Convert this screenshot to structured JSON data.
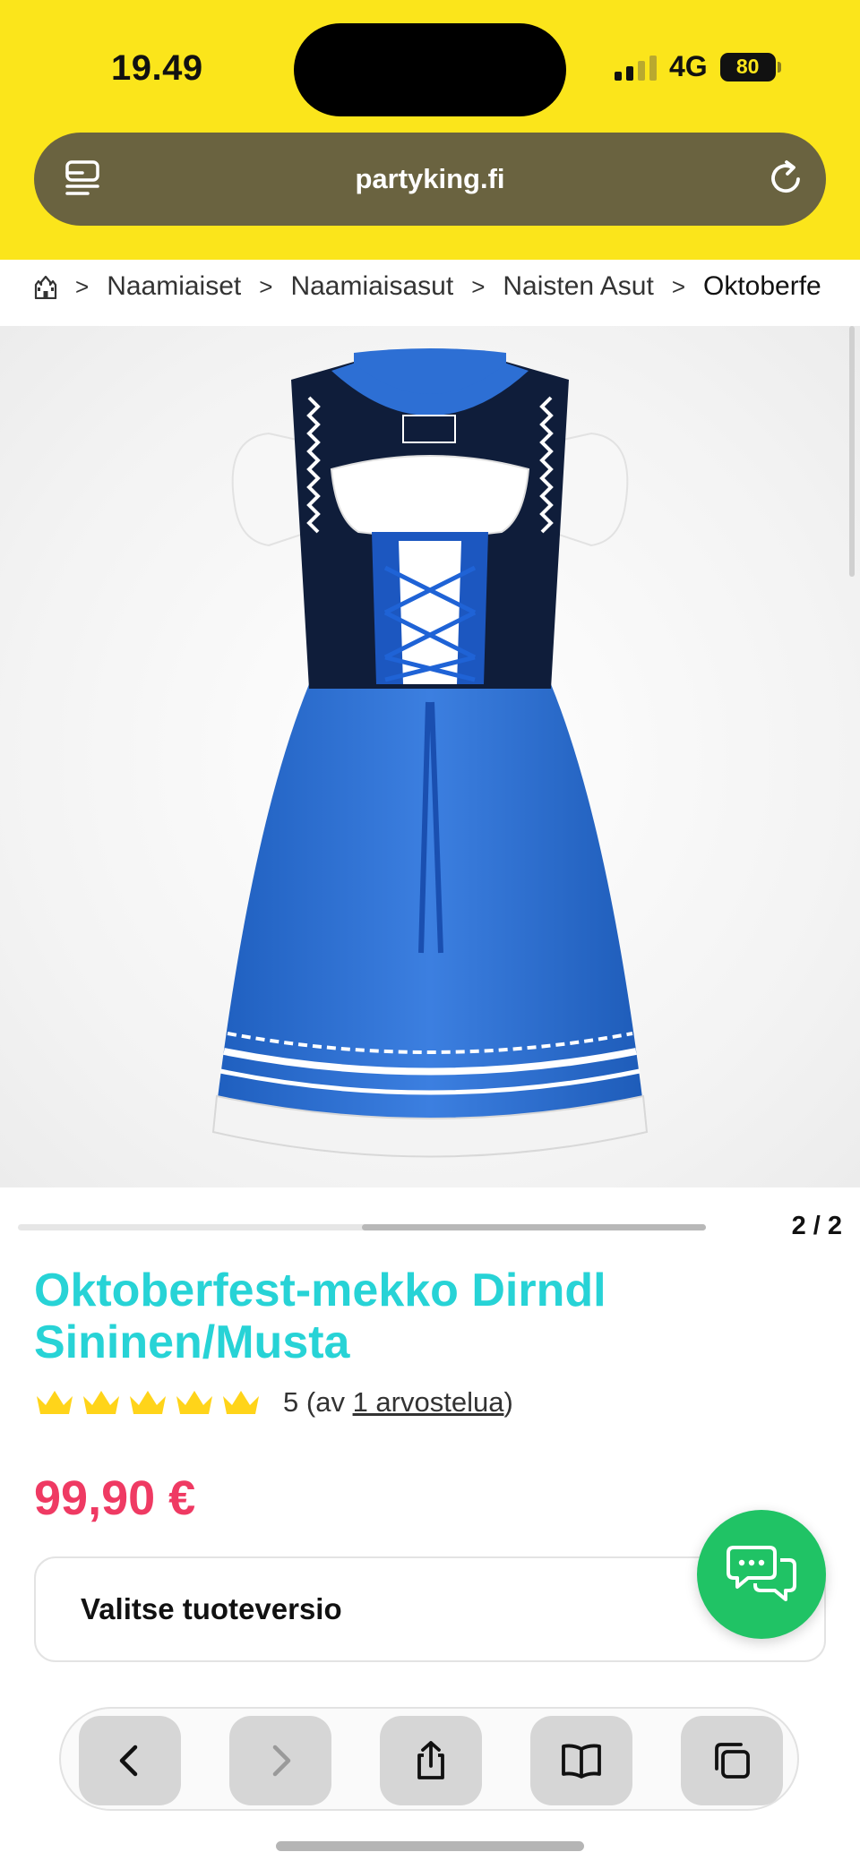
{
  "status_bar": {
    "time": "19.49",
    "network": "4G",
    "battery": "80"
  },
  "address_bar": {
    "url": "partyking.fi"
  },
  "breadcrumb": {
    "items": [
      "Naamiaiset",
      "Naamiaisasut",
      "Naisten Asut",
      "Oktoberfe"
    ]
  },
  "gallery": {
    "counter": "2 / 2",
    "progress": 0.5
  },
  "product": {
    "title": "Oktoberfest-mekko Dirndl Sininen/Musta",
    "rating_value": "5",
    "rating_prefix": "(av ",
    "review_link": "1 arvostelua",
    "rating_suffix": ")",
    "stars": 5,
    "price": "99,90 €",
    "variant_placeholder": "Valitse tuoteversio"
  },
  "colors": {
    "header_yellow": "#fbe51b",
    "title_cyan": "#27d3d6",
    "price_pink": "#ef3a63",
    "chat_green": "#20c365",
    "crown_yellow": "#ffd41a"
  },
  "icons": {
    "tabs": "tabs-list-icon",
    "reload": "reload-icon",
    "home": "castle-home-icon",
    "chat": "chat-bubbles-icon",
    "back": "chevron-left-icon",
    "forward": "chevron-right-icon",
    "share": "share-icon",
    "bookmarks": "book-icon",
    "tab_overview": "tabs-overview-icon"
  }
}
